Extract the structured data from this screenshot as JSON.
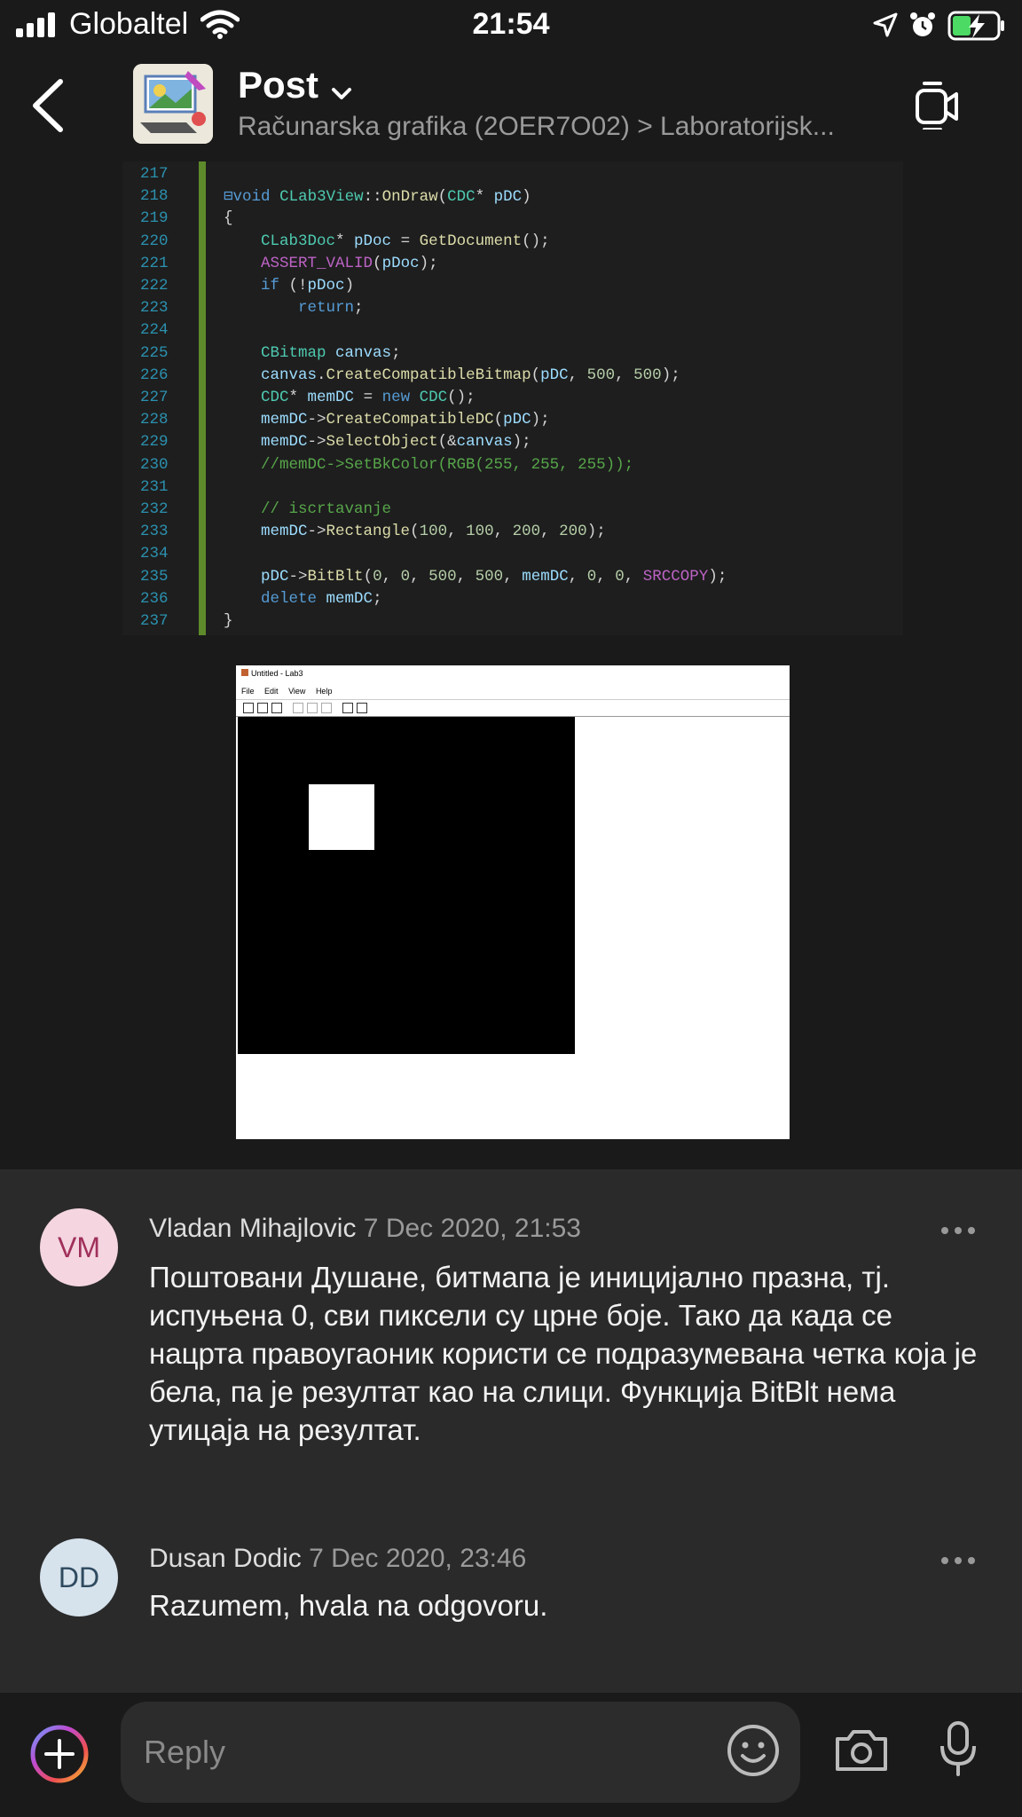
{
  "status_bar": {
    "carrier": "Globaltel",
    "time": "21:54",
    "icons": [
      "signal-icon",
      "wifi-icon",
      "location-icon",
      "alarm-icon",
      "battery-charging-icon"
    ]
  },
  "header": {
    "title": "Post",
    "subtitle": "Računarska grafika (2OER7O02) > Laboratorijsk...",
    "icons": [
      "back-icon",
      "chevron-down-icon",
      "meet-now-icon"
    ]
  },
  "code_image": {
    "lines": [
      {
        "n": "217",
        "html": ""
      },
      {
        "n": "218",
        "html": "<span class='kw'>⊟void</span> <span class='ty'>CLab3View</span>::<span class='fn'>OnDraw</span>(<span class='ty'>CDC</span>* <span class='va'>pDC</span>)"
      },
      {
        "n": "219",
        "html": "{"
      },
      {
        "n": "220",
        "html": "    <span class='ty'>CLab3Doc</span>* <span class='va'>pDoc</span> = <span class='fn'>GetDocument</span>();"
      },
      {
        "n": "221",
        "html": "    <span class='ma'>ASSERT_VALID</span>(<span class='va'>pDoc</span>);"
      },
      {
        "n": "222",
        "html": "    <span class='kw'>if</span> (!<span class='va'>pDoc</span>)"
      },
      {
        "n": "223",
        "html": "        <span class='kw'>return</span>;"
      },
      {
        "n": "224",
        "html": ""
      },
      {
        "n": "225",
        "html": "    <span class='ty'>CBitmap</span> <span class='va'>canvas</span>;"
      },
      {
        "n": "226",
        "html": "    <span class='va'>canvas</span>.<span class='fn'>CreateCompatibleBitmap</span>(<span class='va'>pDC</span>, <span class='nu'>500</span>, <span class='nu'>500</span>);"
      },
      {
        "n": "227",
        "html": "    <span class='ty'>CDC</span>* <span class='va'>memDC</span> = <span class='kw'>new</span> <span class='ty'>CDC</span>();"
      },
      {
        "n": "228",
        "html": "    <span class='va'>memDC</span>-><span class='fn'>CreateCompatibleDC</span>(<span class='va'>pDC</span>);"
      },
      {
        "n": "229",
        "html": "    <span class='va'>memDC</span>-><span class='fn'>SelectObject</span>(&amp;<span class='va'>canvas</span>);"
      },
      {
        "n": "230",
        "html": "    <span class='cm'>//memDC->SetBkColor(RGB(255, 255, 255));</span>"
      },
      {
        "n": "231",
        "html": ""
      },
      {
        "n": "232",
        "html": "    <span class='cm'>// iscrtavanje</span>"
      },
      {
        "n": "233",
        "html": "    <span class='va'>memDC</span>-><span class='fn'>Rectangle</span>(<span class='nu'>100</span>, <span class='nu'>100</span>, <span class='nu'>200</span>, <span class='nu'>200</span>);"
      },
      {
        "n": "234",
        "html": ""
      },
      {
        "n": "235",
        "html": "    <span class='va'>pDC</span>-><span class='fn'>BitBlt</span>(<span class='nu'>0</span>, <span class='nu'>0</span>, <span class='nu'>500</span>, <span class='nu'>500</span>, <span class='va'>memDC</span>, <span class='nu'>0</span>, <span class='nu'>0</span>, <span class='ma'>SRCCOPY</span>);"
      },
      {
        "n": "236",
        "html": "    <span class='kw'>delete</span> <span class='va'>memDC</span>;"
      },
      {
        "n": "237",
        "html": "}"
      }
    ]
  },
  "app_screenshot": {
    "window_title": "Untitled - Lab3",
    "menu": [
      "File",
      "Edit",
      "View",
      "Help"
    ]
  },
  "comments": [
    {
      "initials": "VM",
      "author": "Vladan Mihajlovic",
      "date": "7 Dec 2020, 21:53",
      "text": "Поштовани Душане, битмапа је иницијално празна, тј. испуњена 0, сви пиксели су црне боје. Тако да када се нацрта правоугаоник користи се подразумевана четка која је бела, па је резултат као на слици. Функција BitBlt нема утицаја на резултат."
    },
    {
      "initials": "DD",
      "author": "Dusan Dodic",
      "date": "7 Dec 2020, 23:46",
      "text": "Razumem, hvala na odgovoru."
    }
  ],
  "compose": {
    "placeholder": "Reply",
    "icons": [
      "add-icon",
      "emoji-icon",
      "camera-icon",
      "microphone-icon"
    ]
  },
  "colors": {
    "background": "#1a1a1a",
    "comments_background": "#2a2a2a",
    "battery_green": "#4cd964"
  }
}
